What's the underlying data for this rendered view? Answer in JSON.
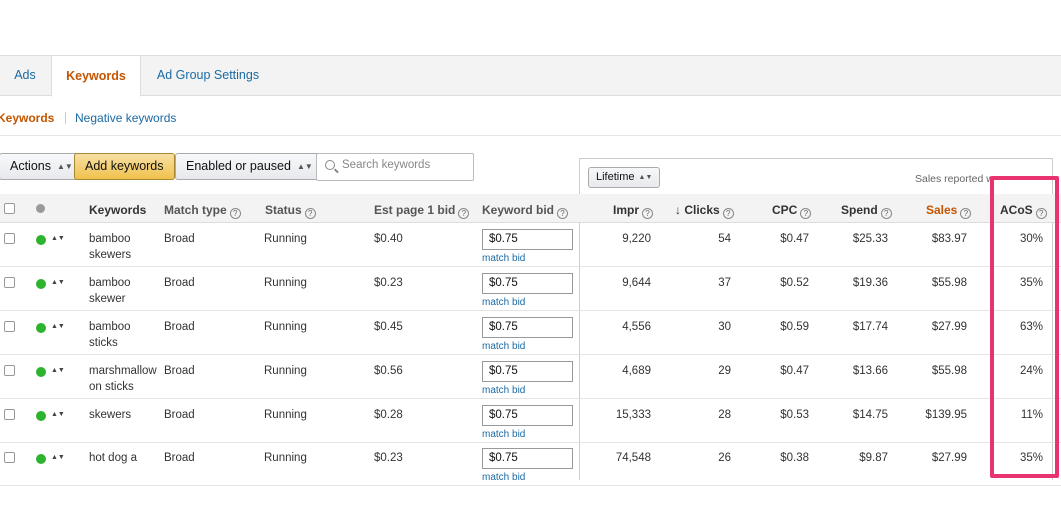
{
  "tabs": [
    "Ads",
    "Keywords",
    "Ad Group Settings"
  ],
  "subnav": {
    "active": "Keywords",
    "link": "Negative keywords"
  },
  "toolbar": {
    "actions_label": "Actions",
    "add_keywords_label": "Add keywords",
    "filter_label": "Enabled or paused",
    "search_placeholder": "Search keywords"
  },
  "panel": {
    "range_label": "Lifetime",
    "note": "Sales reported w"
  },
  "columns": {
    "keywords": "Keywords",
    "match_type": "Match type",
    "status": "Status",
    "est_bid": "Est page 1 bid",
    "keyword_bid": "Keyword bid",
    "impr": "Impr",
    "clicks": "Clicks",
    "cpc": "CPC",
    "spend": "Spend",
    "sales": "Sales",
    "acos": "ACoS"
  },
  "help_glyph": "?",
  "sort_glyph": "↓",
  "caret_glyph": "▲▼",
  "match_bid_label": "match bid",
  "rows": [
    {
      "keyword": "bamboo skewers",
      "match": "Broad",
      "status": "Running",
      "est": "$0.40",
      "bid": "$0.75",
      "impr": "9,220",
      "clicks": "54",
      "cpc": "$0.47",
      "spend": "$25.33",
      "sales": "$83.97",
      "acos": "30%"
    },
    {
      "keyword": "bamboo skewer",
      "match": "Broad",
      "status": "Running",
      "est": "$0.23",
      "bid": "$0.75",
      "impr": "9,644",
      "clicks": "37",
      "cpc": "$0.52",
      "spend": "$19.36",
      "sales": "$55.98",
      "acos": "35%"
    },
    {
      "keyword": "bamboo sticks",
      "match": "Broad",
      "status": "Running",
      "est": "$0.45",
      "bid": "$0.75",
      "impr": "4,556",
      "clicks": "30",
      "cpc": "$0.59",
      "spend": "$17.74",
      "sales": "$27.99",
      "acos": "63%"
    },
    {
      "keyword": "marshmallow on sticks",
      "match": "Broad",
      "status": "Running",
      "est": "$0.56",
      "bid": "$0.75",
      "impr": "4,689",
      "clicks": "29",
      "cpc": "$0.47",
      "spend": "$13.66",
      "sales": "$55.98",
      "acos": "24%"
    },
    {
      "keyword": "skewers",
      "match": "Broad",
      "status": "Running",
      "est": "$0.28",
      "bid": "$0.75",
      "impr": "15,333",
      "clicks": "28",
      "cpc": "$0.53",
      "spend": "$14.75",
      "sales": "$139.95",
      "acos": "11%"
    },
    {
      "keyword": "hot dog a",
      "match": "Broad",
      "status": "Running",
      "est": "$0.23",
      "bid": "$0.75",
      "impr": "74,548",
      "clicks": "26",
      "cpc": "$0.38",
      "spend": "$9.87",
      "sales": "$27.99",
      "acos": "35%"
    }
  ],
  "colors": {
    "accent": "#c45500",
    "link": "#1a6aa3",
    "highlight": "#e8336e",
    "running": "#2db32d"
  }
}
